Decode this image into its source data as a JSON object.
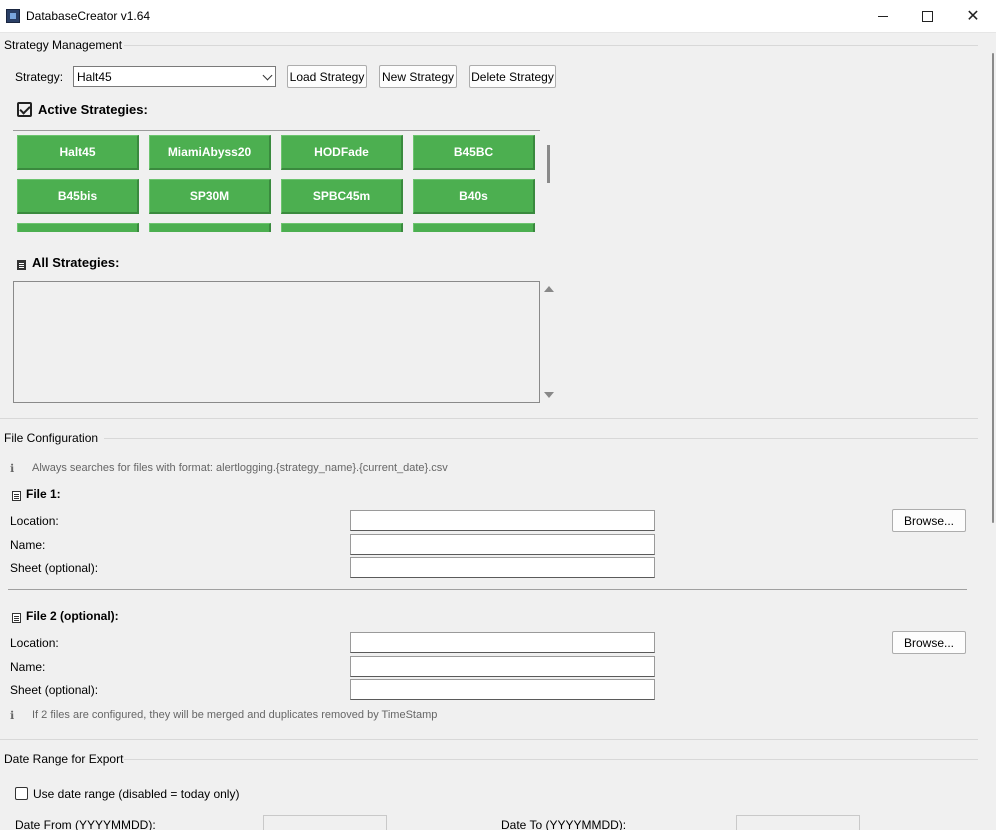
{
  "window": {
    "title": "DatabaseCreator v1.64"
  },
  "strategy_management": {
    "section_title": "Strategy Management",
    "strategy_label": "Strategy:",
    "strategy_selected": "Halt45",
    "load_button": "Load Strategy",
    "new_button": "New Strategy",
    "delete_button": "Delete Strategy",
    "active_heading": "Active Strategies:",
    "active_strategies": [
      "Halt45",
      "MiamiAbyss20",
      "HODFade",
      "B45BC",
      "B45bis",
      "SP30M",
      "SPBC45m",
      "B40s"
    ],
    "all_heading": "All Strategies:"
  },
  "file_configuration": {
    "section_title": "File Configuration",
    "info_icon": "ℹ",
    "info_text": "Always searches for files with format: alertlogging.{strategy_name}.{current_date}.csv",
    "file1": {
      "heading": "File 1:",
      "location_label": "Location:",
      "name_label": "Name:",
      "sheet_label": "Sheet (optional):",
      "location_value": "",
      "name_value": "",
      "sheet_value": "",
      "browse_button": "Browse..."
    },
    "file2": {
      "heading": "File 2 (optional):",
      "location_label": "Location:",
      "name_label": "Name:",
      "sheet_label": "Sheet (optional):",
      "location_value": "",
      "name_value": "",
      "sheet_value": "",
      "browse_button": "Browse..."
    },
    "merge_info_text": "If 2 files are configured, they will be merged and duplicates removed by TimeStamp"
  },
  "date_range": {
    "section_title": "Date Range for Export",
    "use_date_range_label": "Use date range (disabled = today only)",
    "use_date_range_checked": false,
    "date_from_label": "Date From (YYYYMMDD):",
    "date_to_label": "Date To (YYYYMMDD):",
    "date_from_value": "",
    "date_to_value": ""
  }
}
